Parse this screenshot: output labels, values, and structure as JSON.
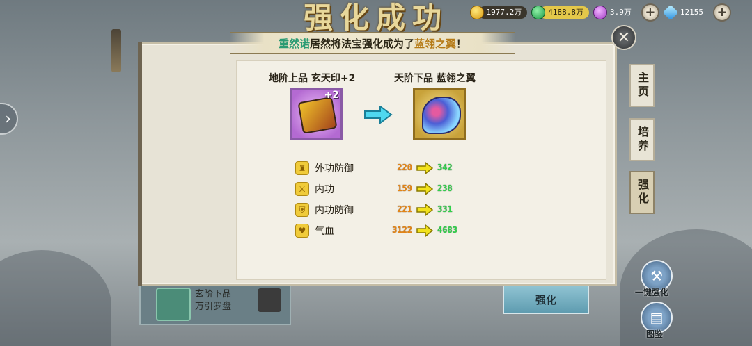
{
  "resources": [
    {
      "name": "gold",
      "icon": "gold-coin-icon",
      "value": "1977.2万"
    },
    {
      "name": "jade",
      "icon": "jade-icon",
      "value": "4188.8万"
    },
    {
      "name": "purple",
      "icon": "purple-orb-icon",
      "value": "3.9万"
    },
    {
      "name": "diamond",
      "icon": "diamond-icon",
      "value": "12155"
    }
  ],
  "banner": {
    "title": "强化成功",
    "announce_part1": "重然诺",
    "announce_middle": " 居然将法宝强化成为了 ",
    "announce_part2": "蓝翎之翼",
    "announce_end": " ！"
  },
  "before_item": {
    "title": "地阶上品 玄天印+2",
    "plus": "+2",
    "color": "#b46ad2"
  },
  "after_item": {
    "title": "天阶下品 蓝翎之翼",
    "color": "#c8a23a"
  },
  "stats": [
    {
      "label": "外功防御",
      "old": "220",
      "new": "342",
      "icon": "armor-icon"
    },
    {
      "label": "内功",
      "old": "159",
      "new": "238",
      "icon": "sword-icon"
    },
    {
      "label": "内功防御",
      "old": "221",
      "new": "331",
      "icon": "shield-icon"
    },
    {
      "label": "气血",
      "old": "3122",
      "new": "4683",
      "icon": "heart-icon"
    }
  ],
  "side_tabs": [
    {
      "label": "主页",
      "active": false
    },
    {
      "label": "培养",
      "active": false
    },
    {
      "label": "强化",
      "active": true
    }
  ],
  "bottom": {
    "item_line1": "玄阶下品",
    "item_line2": "万引罗盘",
    "strengthen_button": "强化",
    "one_key": "一键强化",
    "catalog": "图鉴"
  },
  "colors": {
    "panel_bg": "#e7e3d6",
    "old_value": "#e58514",
    "new_value": "#2fd24a",
    "highlight_name": "#2a9b73",
    "highlight_item": "#b57a16"
  }
}
